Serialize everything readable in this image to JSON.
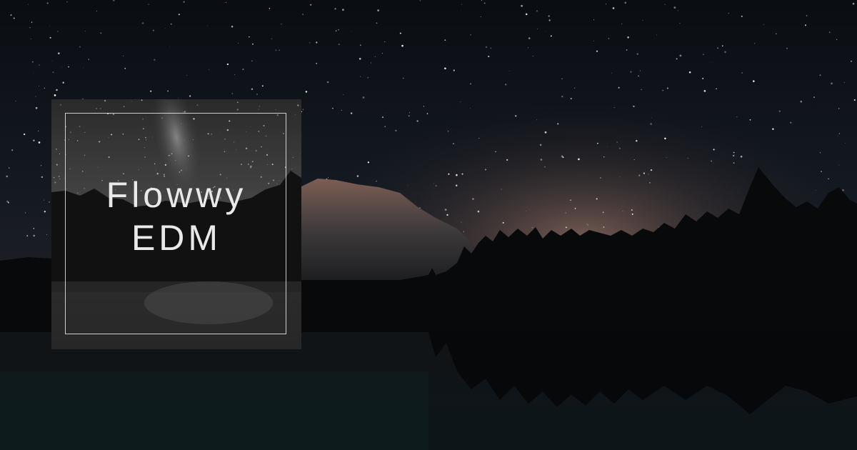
{
  "cover": {
    "title_line_1": "Flowwy",
    "title_line_2": "EDM"
  },
  "colors": {
    "sky": "#0d1016",
    "horizon_glow": "#8a6a5e",
    "cover_background": "#1f1f1f",
    "cover_text": "#e9e9e9"
  }
}
